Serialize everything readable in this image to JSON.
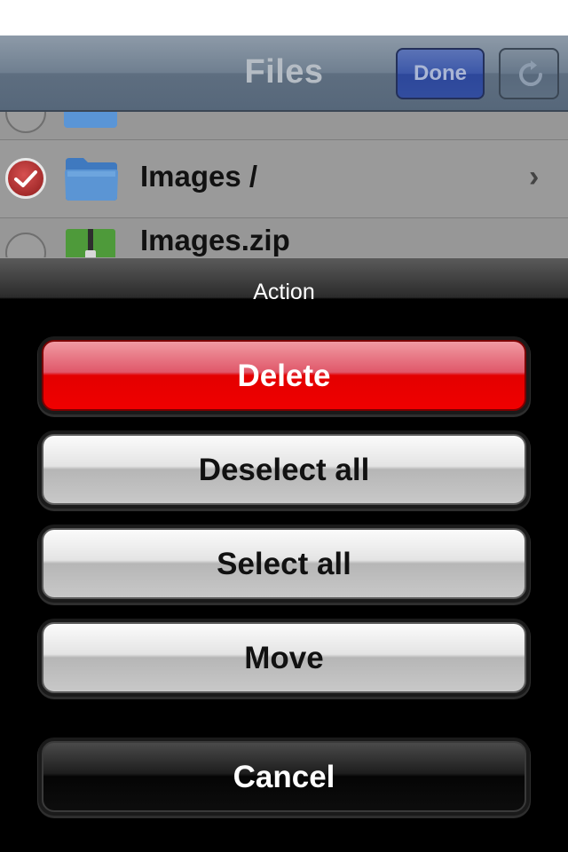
{
  "navbar": {
    "title": "Files",
    "done_label": "Done",
    "refresh_icon": "refresh-icon"
  },
  "file_list": {
    "rows": [
      {
        "label": "",
        "icon": "folder-icon",
        "selected": false
      },
      {
        "label": "Images /",
        "icon": "folder-icon",
        "selected": true,
        "disclosure": "chevron-right-icon"
      },
      {
        "label": "Images.zip",
        "icon": "zip-file-icon",
        "selected": false
      }
    ]
  },
  "action_sheet": {
    "title": "Action",
    "buttons": {
      "delete": "Delete",
      "deselect_all": "Deselect all",
      "select_all": "Select all",
      "move": "Move",
      "cancel": "Cancel"
    }
  },
  "colors": {
    "destructive": "#e30000",
    "done_button": "#3c57a8",
    "navbar": "#6f7f90",
    "sheet_background": "#000000"
  }
}
